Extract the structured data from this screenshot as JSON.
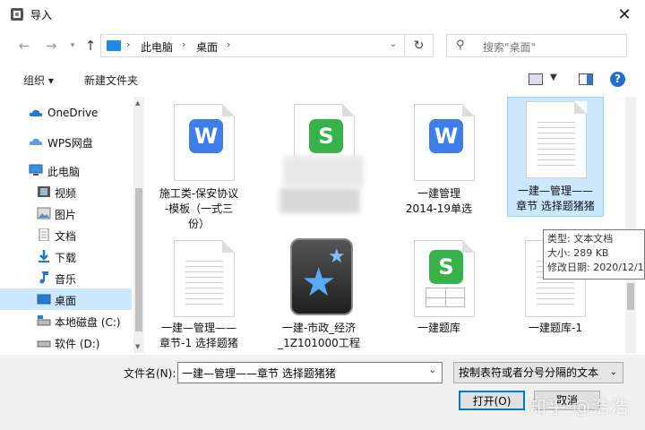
{
  "window": {
    "title": "导入"
  },
  "address": {
    "path": [
      "此电脑",
      "桌面"
    ]
  },
  "search": {
    "placeholder": "搜索\"桌面\""
  },
  "toolbar": {
    "organize": "组织",
    "new_folder": "新建文件夹"
  },
  "sidebar": {
    "items": [
      {
        "label": "OneDrive",
        "icon": "onedrive-icon"
      },
      {
        "label": "WPS网盘",
        "icon": "cloud-icon"
      },
      {
        "label": "此电脑",
        "icon": "computer-icon"
      },
      {
        "label": "视频",
        "icon": "video-icon"
      },
      {
        "label": "图片",
        "icon": "picture-icon"
      },
      {
        "label": "文档",
        "icon": "document-icon"
      },
      {
        "label": "下载",
        "icon": "download-icon"
      },
      {
        "label": "音乐",
        "icon": "music-icon"
      },
      {
        "label": "桌面",
        "icon": "desktop-icon",
        "selected": true
      },
      {
        "label": "本地磁盘 (C:)",
        "icon": "disk-icon"
      },
      {
        "label": "软件 (D:)",
        "icon": "disk-icon"
      }
    ]
  },
  "files": [
    {
      "name": "施工类-保安协议\n-模板（一式三\n份）",
      "icon": "wps-word-icon"
    },
    {
      "name": "",
      "icon": "wps-sheet-icon"
    },
    {
      "name": "一建管理\n2014-19单选",
      "icon": "wps-word-icon"
    },
    {
      "name": "一建—管理——\n章节 选择题猪猪",
      "icon": "text-file-icon",
      "selected": true
    },
    {
      "name": "一建—管理——\n章节-1 选择题猪",
      "icon": "text-file-icon"
    },
    {
      "name": "一建-市政_经济\n_1Z101000工程",
      "icon": "star-app-icon"
    },
    {
      "name": "一建题库",
      "icon": "wps-sheet-icon"
    },
    {
      "name": "一建题库-1",
      "icon": "text-file-icon"
    }
  ],
  "tooltip": {
    "type": "类型: 文本文档",
    "size": "大小: 289 KB",
    "modified": "修改日期: 2020/12/1"
  },
  "bottom": {
    "filename_label": "文件名(N):",
    "filename_value": "一建—管理——章节 选择题猪猪",
    "filetype": "按制表符或者分号分隔的文本",
    "open": "打开(O)",
    "cancel": "取消"
  },
  "watermark": "知乎 @浩浩",
  "colors": {
    "selection": "#cce8ff",
    "accent": "#0078d7",
    "wps_word": "#3d7ee8",
    "wps_sheet": "#38b24a"
  }
}
